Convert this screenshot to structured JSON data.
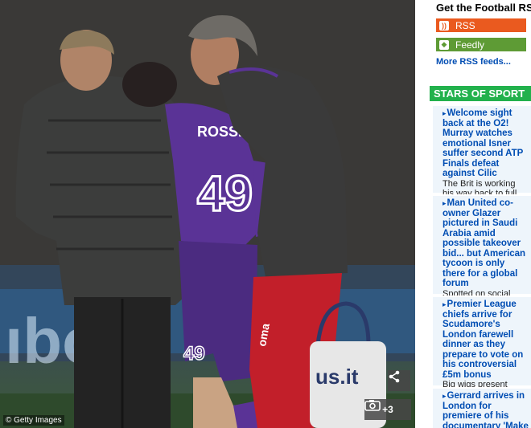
{
  "photo": {
    "credit": "© Getty Images",
    "shirt_name": "ROSSI",
    "shirt_number": "49",
    "shorts_number": "49",
    "share_icon": "share-icon",
    "gallery_icon": "camera-icon",
    "gallery_count": "+3",
    "bag_brand": "us.it",
    "trouser_brand": "oma"
  },
  "sidebar": {
    "rss": {
      "title": "Get the Football RSS",
      "links": [
        {
          "label": "RSS",
          "icon": "rss-icon",
          "color": "#ea5a1f"
        },
        {
          "label": "Feedly",
          "icon": "feedly-icon",
          "color": "#5e9b35"
        }
      ],
      "more": "More RSS feeds..."
    },
    "stars": {
      "heading": "STARS OF SPORT",
      "color": "#22b14c",
      "stories": [
        {
          "headline": "Welcome sight back at the O2! Murray watches emotional Isner suffer second ATP Finals defeat against Cilic",
          "sub": "The Brit is working his way back to full fitness"
        },
        {
          "headline": "Man United co-owner Glazer pictured in Saudi Arabia amid possible takeover bid... but American tycoon is only there for a global forum",
          "sub": "Spotted on social media"
        },
        {
          "headline": "Premier League chiefs arrive for Scudamore's London farewell dinner as they prepare to vote on his controversial £5m bonus",
          "sub": "Big wigs present"
        },
        {
          "headline": "Gerrard arrives in London for premiere of his documentary 'Make Us Dream' with",
          "sub": ""
        }
      ]
    }
  }
}
